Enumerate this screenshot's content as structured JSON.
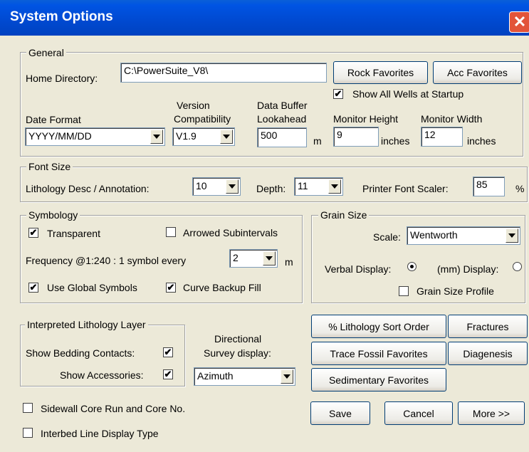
{
  "window": {
    "title": "System Options",
    "close": "✕"
  },
  "general": {
    "legend": "General",
    "home_label": "Home Directory:",
    "home_value": "C:\\PowerSuite_V8\\",
    "rock_fav": "Rock Favorites",
    "acc_fav": "Acc Favorites",
    "show_wells": {
      "label": "Show All Wells at Startup",
      "checked": true
    },
    "date_format_label": "Date Format",
    "date_format_value": "YYYY/MM/DD",
    "version_label_1": "Version",
    "version_label_2": "Compatibility",
    "version_value": "V1.9",
    "buffer_label_1": "Data Buffer",
    "buffer_label_2": "Lookahead",
    "buffer_value": "500",
    "buffer_unit": "m",
    "monitor_h_label": "Monitor Height",
    "monitor_h_value": "9",
    "monitor_h_unit": "inches",
    "monitor_w_label": "Monitor Width",
    "monitor_w_value": "12",
    "monitor_w_unit": "inches"
  },
  "font_size": {
    "legend": "Font Size",
    "litho_label": "Lithology Desc / Annotation:",
    "litho_value": "10",
    "depth_label": "Depth:",
    "depth_value": "11",
    "printer_label": "Printer Font Scaler:",
    "printer_value": "85",
    "printer_unit": "%"
  },
  "symbology": {
    "legend": "Symbology",
    "transparent": {
      "label": "Transparent",
      "checked": true
    },
    "arrowed": {
      "label": "Arrowed Subintervals",
      "checked": false
    },
    "freq_label": "Frequency @1:240 : 1 symbol every",
    "freq_value": "2",
    "freq_unit": "m",
    "global_symbols": {
      "label": "Use Global Symbols",
      "checked": true
    },
    "curve_backup": {
      "label": "Curve Backup Fill",
      "checked": true
    }
  },
  "grain": {
    "legend": "Grain Size",
    "scale_label": "Scale:",
    "scale_value": "Wentworth",
    "verbal_label": "Verbal Display:",
    "mm_label": "(mm) Display:",
    "profile": {
      "label": "Grain Size Profile",
      "checked": false
    }
  },
  "interp": {
    "legend": "Interpreted Lithology Layer",
    "bedding": {
      "label": "Show Bedding Contacts:",
      "checked": true
    },
    "accessories": {
      "label": "Show Accessories:",
      "checked": true
    }
  },
  "survey": {
    "label_1": "Directional",
    "label_2": "Survey display:",
    "value": "Azimuth"
  },
  "sidewall": {
    "label": "Sidewall Core Run and Core No.",
    "checked": false
  },
  "interbed": {
    "label": "Interbed Line Display Type",
    "checked": false
  },
  "buttons": {
    "litho_sort": "% Lithology Sort Order",
    "fractures": "Fractures",
    "trace_fossil": "Trace Fossil Favorites",
    "diagenesis": "Diagenesis",
    "sedimentary": "Sedimentary Favorites",
    "save": "Save",
    "cancel": "Cancel",
    "more": "More >>"
  }
}
